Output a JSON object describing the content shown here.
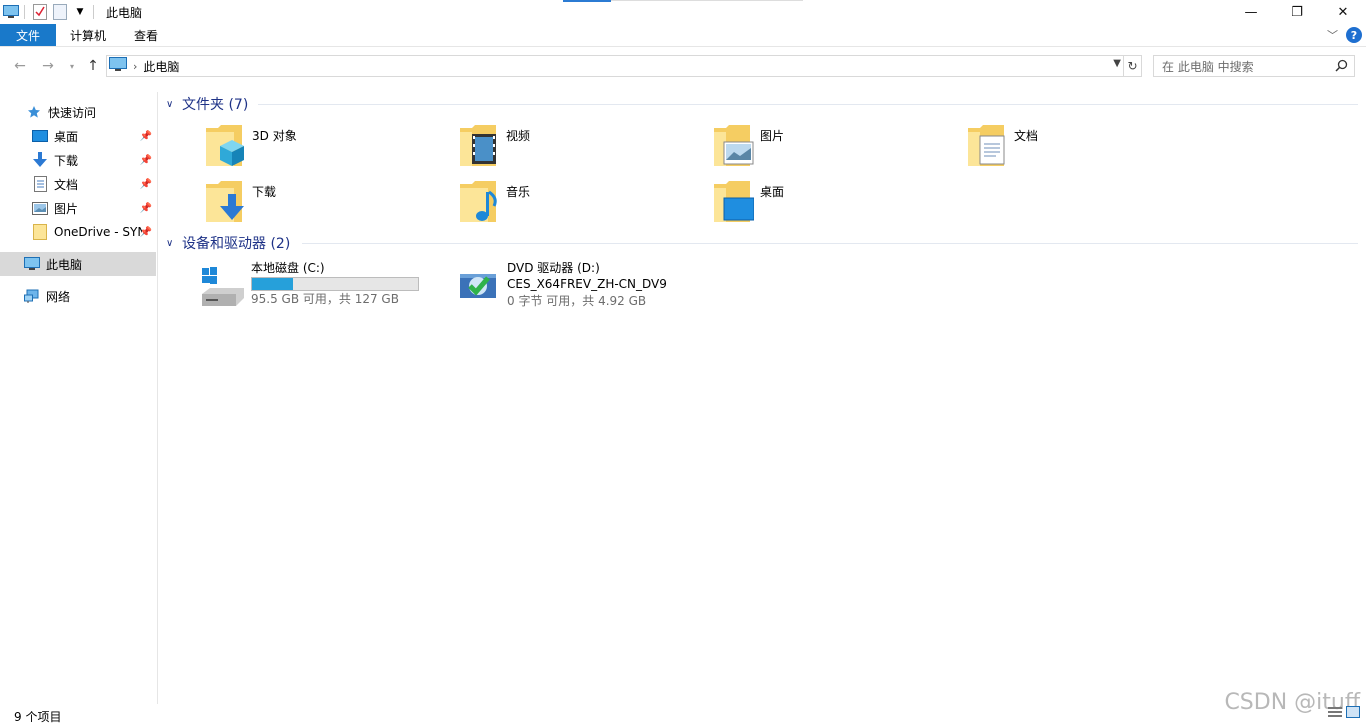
{
  "window": {
    "title": "此电脑",
    "minimize_label": "—",
    "restore_label": "❐",
    "close_label": "✕"
  },
  "ribbon": {
    "tabs": [
      "文件",
      "计算机",
      "查看"
    ],
    "expand_label": "﹀",
    "help_label": "?"
  },
  "address": {
    "path": "此电脑",
    "search_placeholder": "在 此电脑 中搜索"
  },
  "sidebar": {
    "quick_access": "快速访问",
    "items": [
      {
        "label": "桌面",
        "pinned": true
      },
      {
        "label": "下载",
        "pinned": true
      },
      {
        "label": "文档",
        "pinned": true
      },
      {
        "label": "图片",
        "pinned": true
      },
      {
        "label": "OneDrive - SYN",
        "pinned": true
      }
    ],
    "this_pc": "此电脑",
    "network": "网络"
  },
  "folders_group": {
    "title": "文件夹 (7)",
    "items": [
      "3D 对象",
      "视频",
      "图片",
      "文档",
      "下载",
      "音乐",
      "桌面"
    ]
  },
  "drives_group": {
    "title": "设备和驱动器 (2)",
    "drives": [
      {
        "name": "本地磁盘 (C:)",
        "free_text": "95.5 GB 可用，共 127 GB",
        "used_fraction": 0.248
      },
      {
        "name": "DVD 驱动器 (D:)",
        "volume_label": "CES_X64FREV_ZH-CN_DV9",
        "free_text": "0 字节 可用，共 4.92 GB"
      }
    ]
  },
  "status": {
    "count": "9 个项目"
  },
  "watermark": "CSDN @ituff",
  "colors": {
    "accent": "#1979ca",
    "group_header": "#1e3287",
    "drive_bar": "#26a0da",
    "selection": "#d9d9d9"
  }
}
